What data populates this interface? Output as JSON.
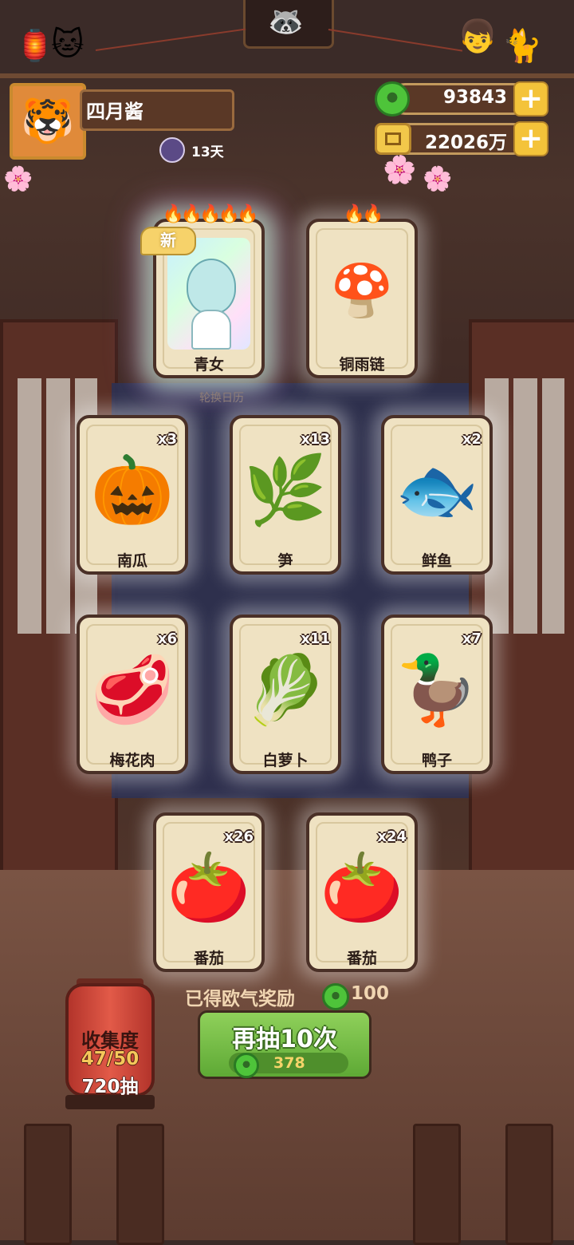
{
  "player": {
    "name": "四月酱",
    "days": "13天"
  },
  "currency": {
    "jade": "93843",
    "coins": "22026万"
  },
  "top_draws": [
    {
      "name": "青女",
      "flames": "🔥🔥🔥🔥🔥",
      "badge": "新"
    },
    {
      "name": "铜雨链",
      "flames": "🔥🔥"
    }
  ],
  "calendar_label": "轮换日历",
  "cards": [
    {
      "name": "南瓜",
      "count": "x3",
      "icon": "pumpkin-icon",
      "art": "🎃"
    },
    {
      "name": "笋",
      "count": "x13",
      "icon": "bamboo-shoot-icon",
      "art": "🌿"
    },
    {
      "name": "鲜鱼",
      "count": "x2",
      "icon": "fish-icon",
      "art": "🐟"
    },
    {
      "name": "梅花肉",
      "count": "x6",
      "icon": "meat-icon",
      "art": "🥩"
    },
    {
      "name": "白萝卜",
      "count": "x11",
      "icon": "radish-icon",
      "art": "🥬"
    },
    {
      "name": "鸭子",
      "count": "x7",
      "icon": "duck-icon",
      "art": "🦆"
    },
    {
      "name": "番茄",
      "count": "x26",
      "icon": "tomato-icon",
      "art": "🍅"
    },
    {
      "name": "番茄",
      "count": "x24",
      "icon": "tomato-icon",
      "art": "🍅"
    }
  ],
  "reward": {
    "label": "已得欧气奖励",
    "value": "100"
  },
  "draw_button": {
    "label": "再抽10次",
    "cost": "378"
  },
  "collection": {
    "title": "收集度",
    "progress": "47/50",
    "draws": "720抽"
  },
  "colors": {
    "jade": "#4ec43a",
    "gold": "#f4c33a",
    "card_bg": "#efe2c2",
    "button_green": "#7cc24a"
  }
}
